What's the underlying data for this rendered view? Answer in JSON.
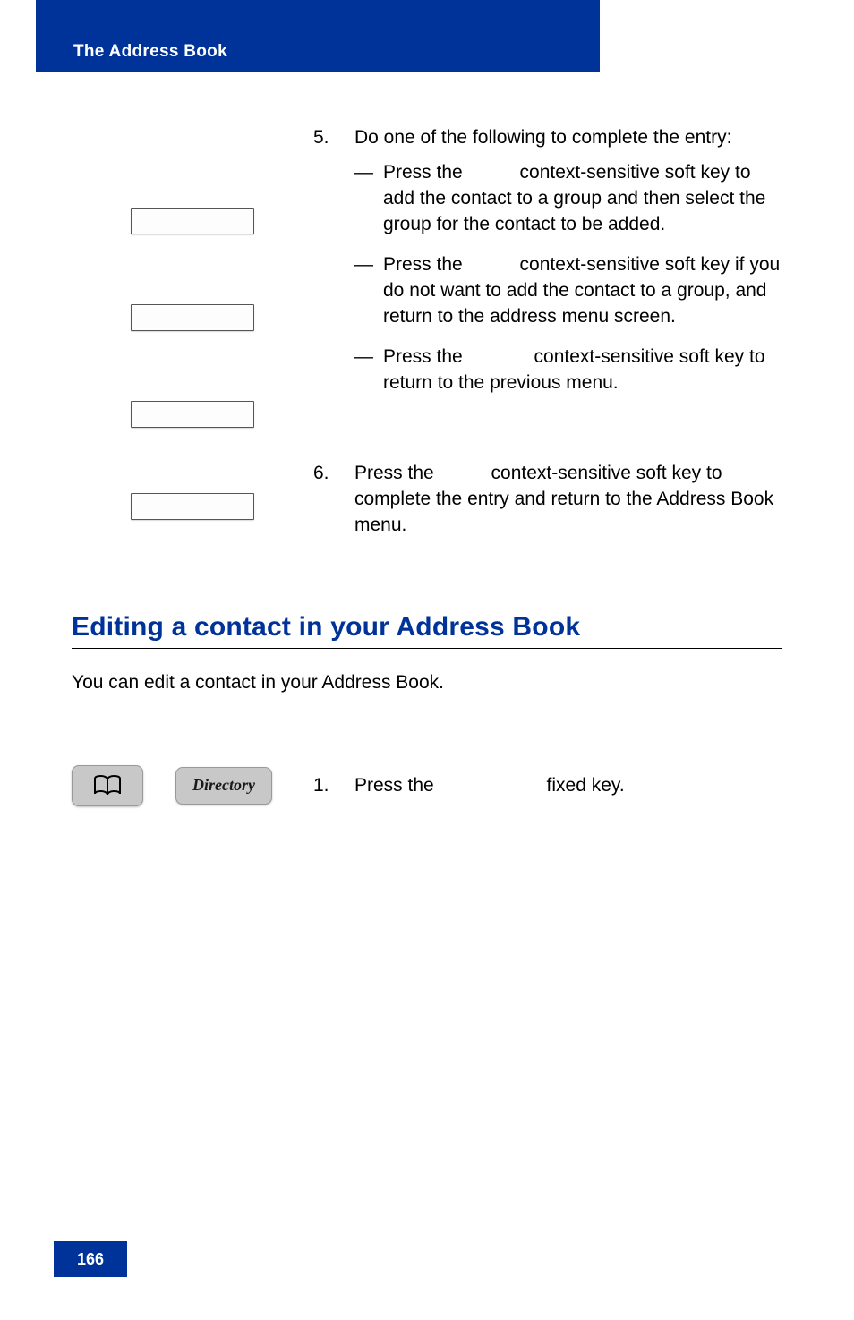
{
  "header": {
    "title": "The Address Book"
  },
  "step5": {
    "number": "5.",
    "intro": "Do one of the following to complete the entry:",
    "items": [
      {
        "dash": "—",
        "pre": "Press the",
        "post": " context-sensitive soft key to add the contact to a group and then select the group for the contact to be added."
      },
      {
        "dash": "—",
        "pre": "Press the",
        "post": " context-sensitive soft key if you do not want to add the contact to a group, and return to the address menu screen."
      },
      {
        "dash": "—",
        "pre": "Press the",
        "post": " context-sensitive soft key to return to the previous menu."
      }
    ]
  },
  "step6": {
    "number": "6.",
    "pre": "Press the",
    "post": " context-sensitive soft key to complete the entry and return to the Address Book menu."
  },
  "section": {
    "heading": "Editing a contact in your Address Book",
    "intro": "You can edit a contact in your Address Book."
  },
  "directory_key_label": "Directory",
  "step1": {
    "number": "1.",
    "pre": "Press the",
    "post": " fixed key."
  },
  "page_number": "166"
}
